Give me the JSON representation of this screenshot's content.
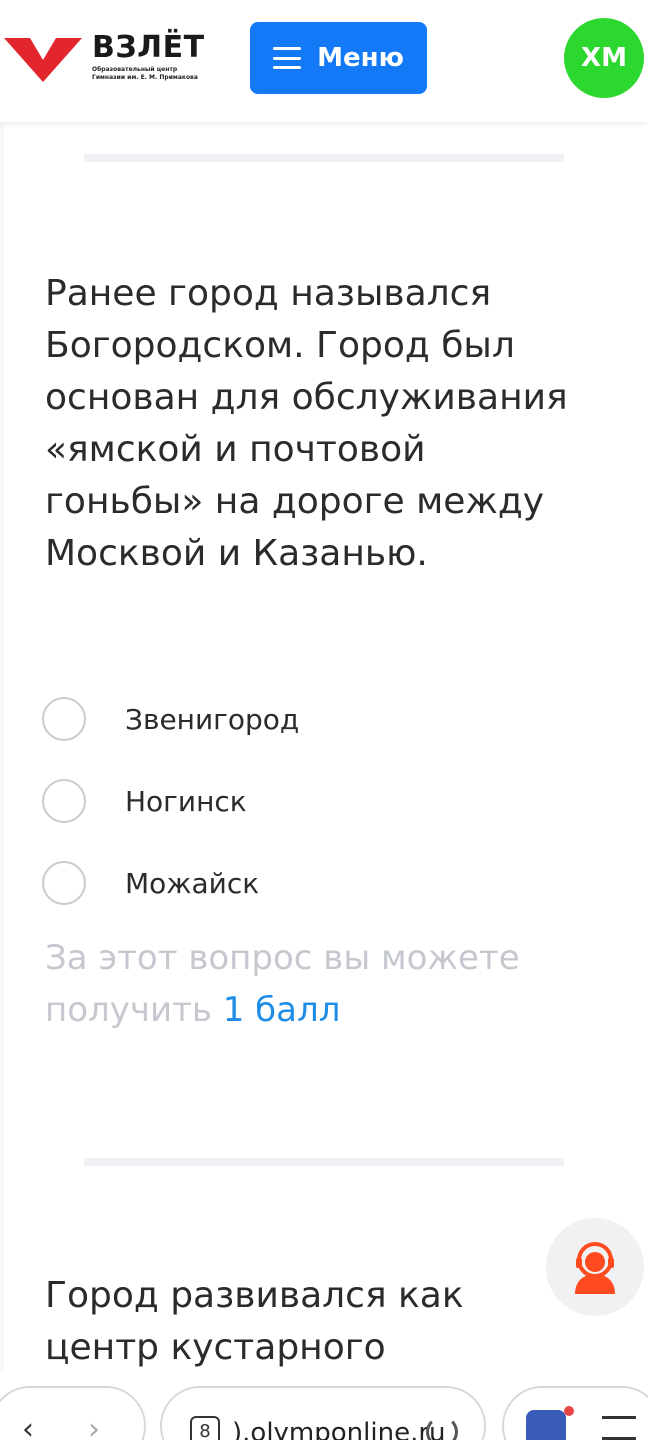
{
  "header": {
    "logo_title": "ВЗЛЁТ",
    "logo_subtitle_1": "Образовательный центр",
    "logo_subtitle_2": "Гимназии им. Е. М. Примакова",
    "menu_label": "Меню",
    "avatar_initials": "ХМ"
  },
  "question": {
    "text": "Ранее город назывался Богородском. Город был основан для обслуживания «ямской и почтовой гоньбы» на дороге между Москвой и Казанью.",
    "options": [
      "Звенигород",
      "Ногинск",
      "Можайск"
    ],
    "points_prefix": "За этот вопрос вы можете получить",
    "points_value": "1 балл"
  },
  "next_question": {
    "text": "Город развивался как центр кустарного производства, а"
  },
  "browser": {
    "tab_count": "8",
    "url": ").olymponline.ru"
  },
  "colors": {
    "brand_red": "#e3262e",
    "menu_blue": "#1379f6",
    "avatar_green": "#2cd72f",
    "points_blue": "#1f8de6",
    "support_orange": "#ff4b1f"
  }
}
